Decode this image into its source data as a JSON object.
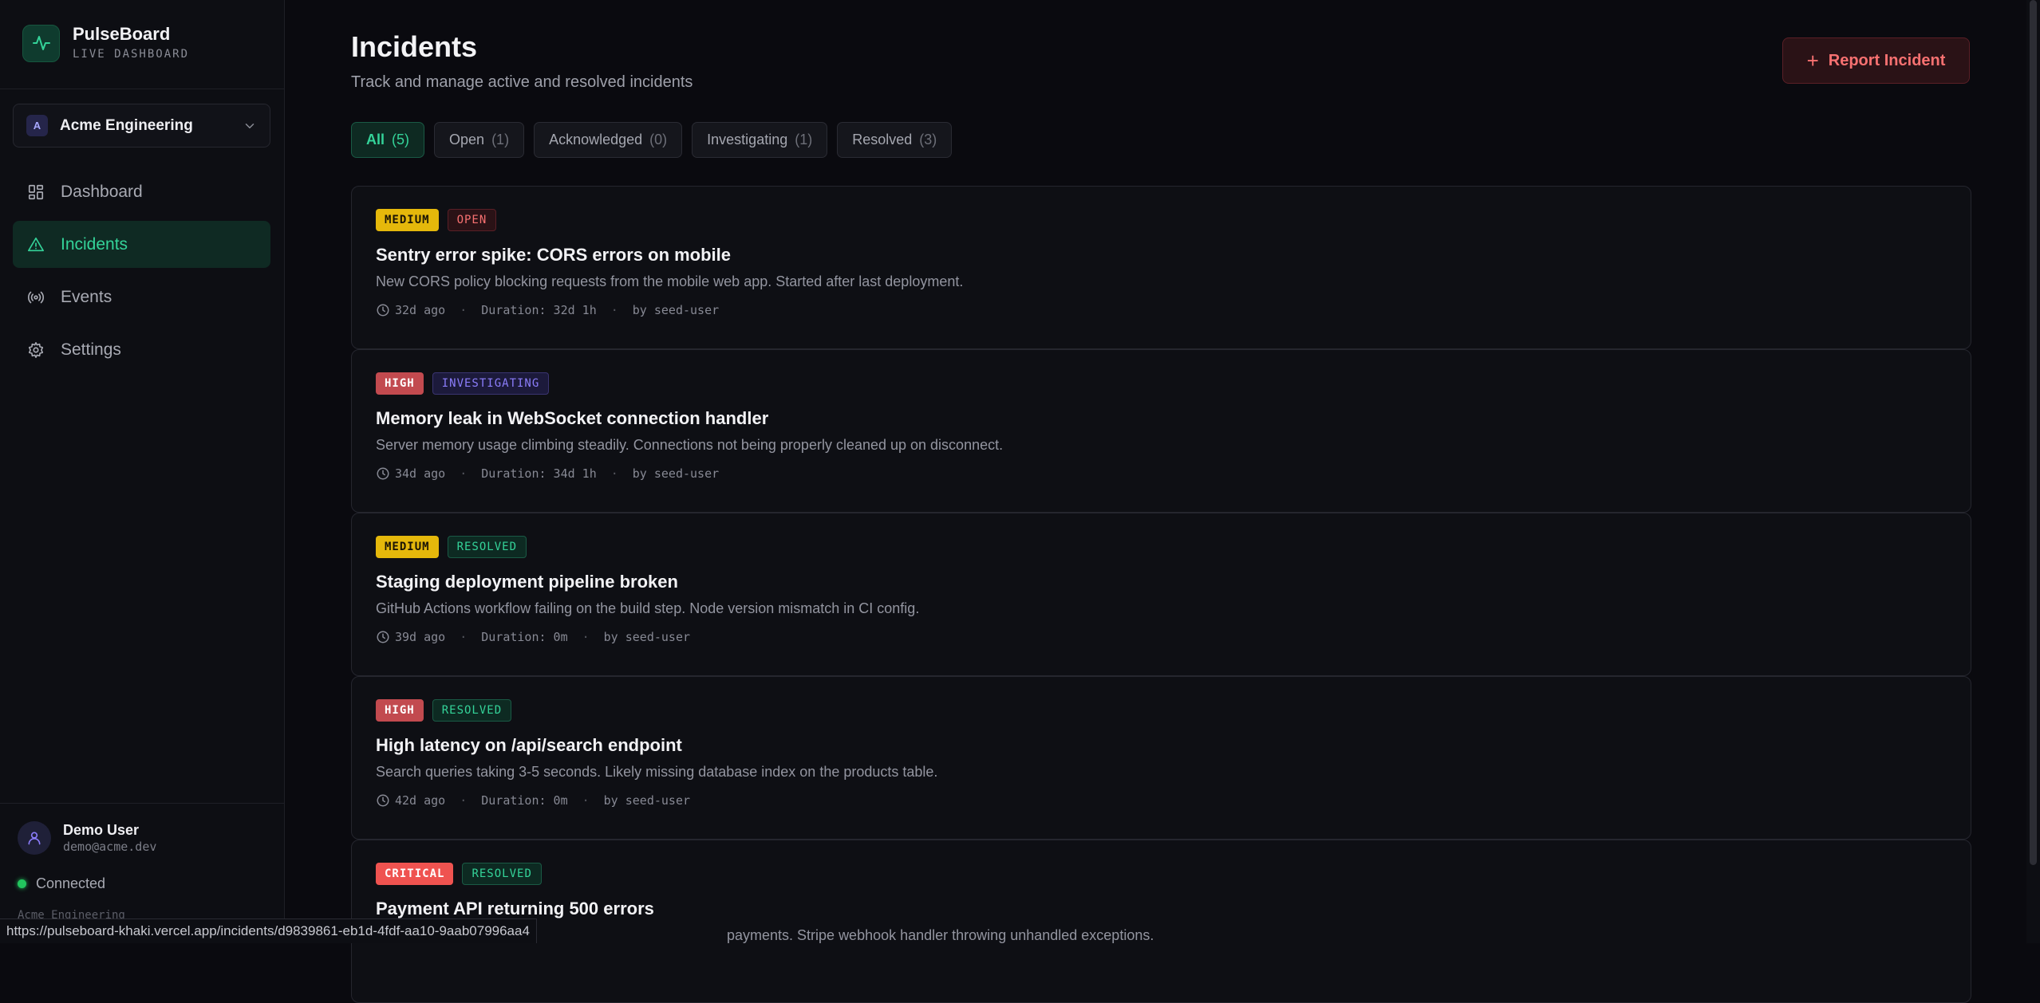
{
  "brand": {
    "name": "PulseBoard",
    "subtitle": "LIVE DASHBOARD"
  },
  "org": {
    "initial": "A",
    "name": "Acme Engineering"
  },
  "nav": [
    {
      "label": "Dashboard",
      "icon": "grid-icon"
    },
    {
      "label": "Incidents",
      "icon": "warning-triangle-icon",
      "active": true
    },
    {
      "label": "Events",
      "icon": "radio-broadcast-icon"
    },
    {
      "label": "Settings",
      "icon": "gear-icon"
    }
  ],
  "user": {
    "name": "Demo User",
    "email": "demo@acme.dev",
    "connection": "Connected",
    "org": "Acme Engineering"
  },
  "page": {
    "title": "Incidents",
    "subtitle": "Track and manage active and resolved incidents",
    "report_button": "Report Incident"
  },
  "filters": [
    {
      "label": "All",
      "count": "(5)",
      "active": true
    },
    {
      "label": "Open",
      "count": "(1)"
    },
    {
      "label": "Acknowledged",
      "count": "(0)"
    },
    {
      "label": "Investigating",
      "count": "(1)"
    },
    {
      "label": "Resolved",
      "count": "(3)"
    }
  ],
  "incidents": [
    {
      "severity": "MEDIUM",
      "status": "OPEN",
      "title": "Sentry error spike: CORS errors on mobile",
      "description": "New CORS policy blocking requests from the mobile web app. Started after last deployment.",
      "ago": "32d ago",
      "duration": "Duration: 32d 1h",
      "by": "by seed-user"
    },
    {
      "severity": "HIGH",
      "status": "INVESTIGATING",
      "title": "Memory leak in WebSocket connection handler",
      "description": "Server memory usage climbing steadily. Connections not being properly cleaned up on disconnect.",
      "ago": "34d ago",
      "duration": "Duration: 34d 1h",
      "by": "by seed-user"
    },
    {
      "severity": "MEDIUM",
      "status": "RESOLVED",
      "title": "Staging deployment pipeline broken",
      "description": "GitHub Actions workflow failing on the build step. Node version mismatch in CI config.",
      "ago": "39d ago",
      "duration": "Duration: 0m",
      "by": "by seed-user"
    },
    {
      "severity": "HIGH",
      "status": "RESOLVED",
      "title": "High latency on /api/search endpoint",
      "description": "Search queries taking 3-5 seconds. Likely missing database index on the products table.",
      "ago": "42d ago",
      "duration": "Duration: 0m",
      "by": "by seed-user"
    },
    {
      "severity": "CRITICAL",
      "status": "RESOLVED",
      "title": "Payment API returning 500 errors",
      "description": "payments. Stripe webhook handler throwing unhandled exceptions.",
      "ago": "",
      "duration": "",
      "by": ""
    }
  ],
  "status_url": "https://pulseboard-khaki.vercel.app/incidents/d9839861-eb1d-4fdf-aa10-9aab07996aa4",
  "colors": {
    "accent": "#34d399",
    "danger": "#f87171",
    "medium": "#e5b80b",
    "high": "#c24a4f",
    "critical": "#ef5350",
    "investigating": "#8b7dfa"
  }
}
